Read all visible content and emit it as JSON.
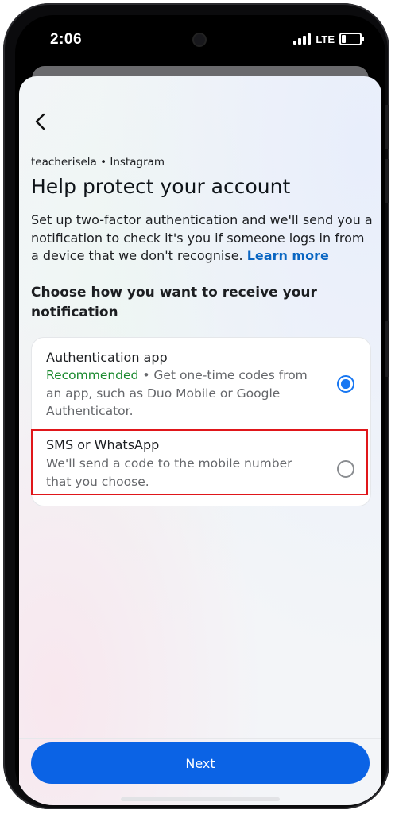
{
  "status_bar": {
    "time": "2:06",
    "network": "LTE",
    "icons": [
      "signal-icon",
      "battery-icon"
    ]
  },
  "header": {
    "back_icon": "chevron-left-icon",
    "account_context": "teacherisela • Instagram",
    "title": "Help protect your account",
    "description": "Set up two-factor authentication and we'll send you a notification to check it's you if someone logs in from a device that we don't recognise.",
    "learn_more": "Learn more"
  },
  "section": {
    "prompt": "Choose how you want to receive your notification"
  },
  "options": [
    {
      "title": "Authentication app",
      "recommended": "Recommended",
      "description": " • Get one-time codes from an app, such as Duo Mobile or Google Authenticator.",
      "selected": true
    },
    {
      "title": "SMS or WhatsApp",
      "description": "We'll send a code to the mobile number that you choose.",
      "selected": false
    }
  ],
  "footer": {
    "next_label": "Next"
  },
  "colors": {
    "accent": "#0b63e5",
    "link": "#0a66c2",
    "recommended": "#1b8a2f",
    "highlight": "#e0161a"
  }
}
